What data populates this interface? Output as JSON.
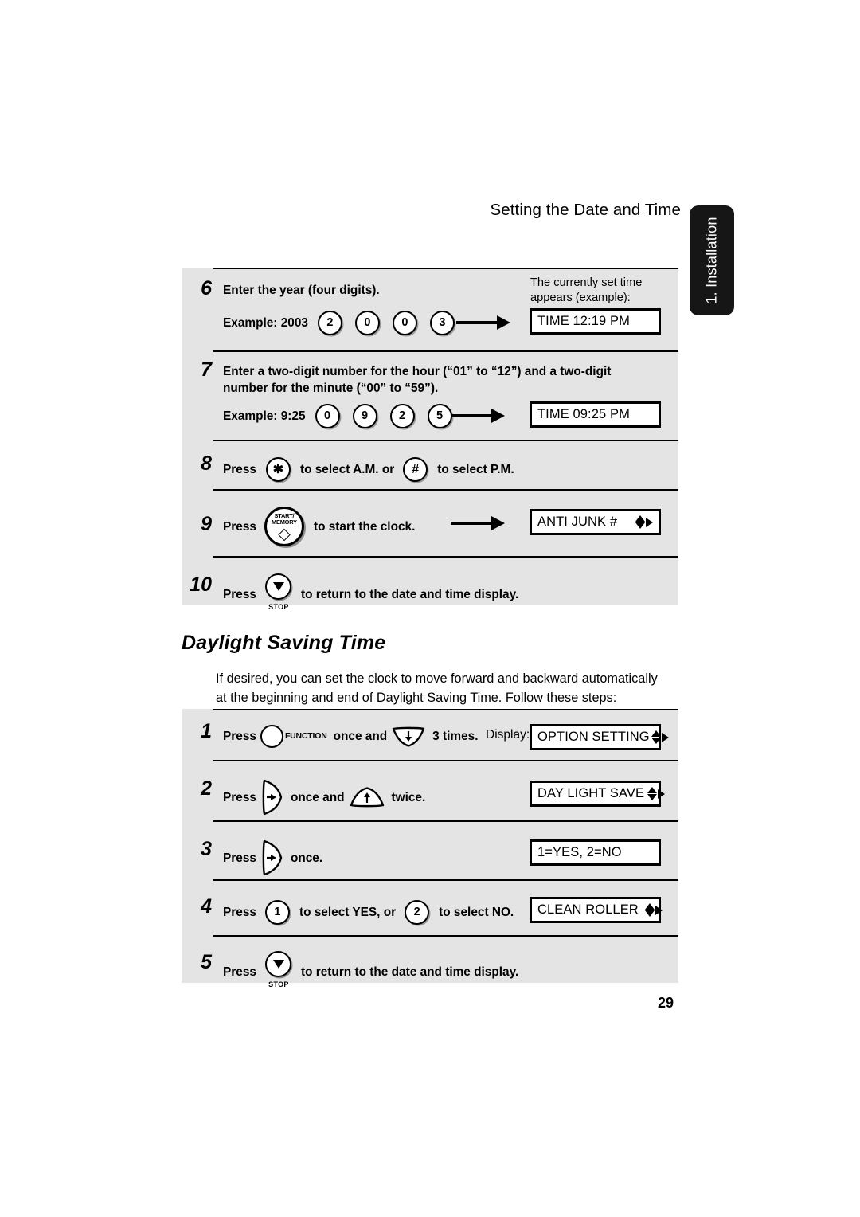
{
  "header": {
    "running_head": "Setting the Date and Time",
    "side_tab": "1. Installation"
  },
  "panel_a": {
    "note": "The currently set time\nappears (example):",
    "steps": [
      {
        "num": "6",
        "text_line1": "Enter the year (four digits).",
        "example_label": "Example: 2003",
        "keys": [
          "2",
          "0",
          "0",
          "3"
        ],
        "lcd": "TIME 12:19 PM"
      },
      {
        "num": "7",
        "text_line1": "Enter a two-digit number for the hour (“01” to “12”) and a two-digit",
        "text_line2": "number for the minute (“00” to “59”).",
        "example_label": "Example: 9:25",
        "keys": [
          "0",
          "9",
          "2",
          "5"
        ],
        "lcd": "TIME 09:25 PM"
      },
      {
        "num": "8",
        "press_label": "Press",
        "key_am": "✳",
        "mid_text": "to select A.M. or",
        "key_pm": "#",
        "end_text": "to select P.M."
      },
      {
        "num": "9",
        "press_label": "Press",
        "key_line1": "START/",
        "key_line2": "MEMORY",
        "after_text": "to start the clock.",
        "lcd": "ANTI JUNK #"
      },
      {
        "num": "10",
        "press_label": "Press",
        "key_label": "STOP",
        "after_text": "to return to the date and time display."
      }
    ]
  },
  "section": {
    "title": "Daylight Saving Time",
    "intro_line1": "If desired, you can set the clock to move forward and backward automatically",
    "intro_line2": "at the beginning and end of Daylight Saving Time. Follow these steps:"
  },
  "panel_b": {
    "display_label": "Display:",
    "steps": [
      {
        "num": "1",
        "press_label": "Press",
        "function_label": "FUNCTION",
        "mid_text": "once and",
        "end_text": "3 times.",
        "lcd": "OPTION SETTING"
      },
      {
        "num": "2",
        "press_label": "Press",
        "mid_text": "once and",
        "end_text": "twice.",
        "lcd": "DAY LIGHT SAVE"
      },
      {
        "num": "3",
        "press_label": "Press",
        "end_text": "once.",
        "lcd": "1=YES, 2=NO"
      },
      {
        "num": "4",
        "press_label": "Press",
        "key_yes": "1",
        "mid_text": "to select YES, or",
        "key_no": "2",
        "end_text": "to select NO.",
        "lcd": "CLEAN ROLLER"
      },
      {
        "num": "5",
        "press_label": "Press",
        "key_label": "STOP",
        "after_text": "to return to the date and time display."
      }
    ]
  },
  "folio": "29"
}
